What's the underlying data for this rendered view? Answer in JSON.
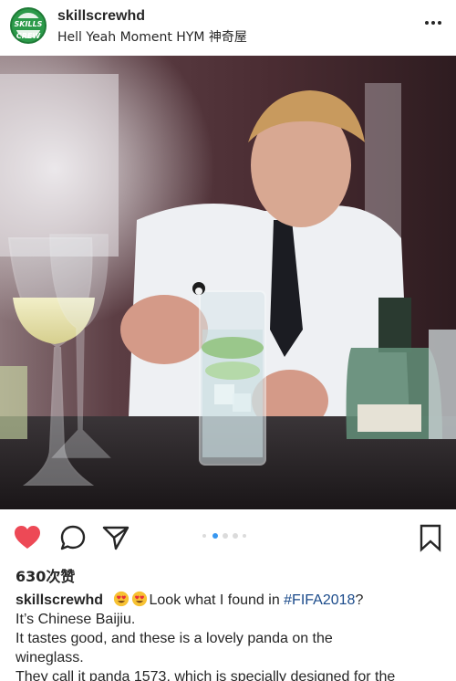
{
  "post": {
    "username": "skillscrewhd",
    "location": "Hell Yeah Moment HYM 神奇屋",
    "avatar_text": "SKILLS CREW",
    "likes": "630次赞",
    "caption": {
      "username": "skillscrewhd",
      "emojis": [
        "heart-eyes-emoji",
        "heart-eyes-emoji"
      ],
      "text_before_tag": "Look what I found in ",
      "hashtag": "#FIFA2018",
      "text_after_tag": "?",
      "lines": [
        "It’s  Chinese Baijiu.",
        "It tastes good, and these is a lovely panda on the",
        "wineglass.",
        "They call it panda 1573, which is specially designed for the"
      ]
    },
    "carousel": {
      "count": 5,
      "active": 1
    }
  },
  "colors": {
    "like_red": "#ed4956",
    "active_dot": "#3897f0",
    "inactive_dot": "#dbdbdb",
    "hashtag": "#1a4a8a"
  },
  "icons": [
    "more-options-icon",
    "heart-icon",
    "comment-icon",
    "share-icon",
    "bookmark-icon"
  ]
}
